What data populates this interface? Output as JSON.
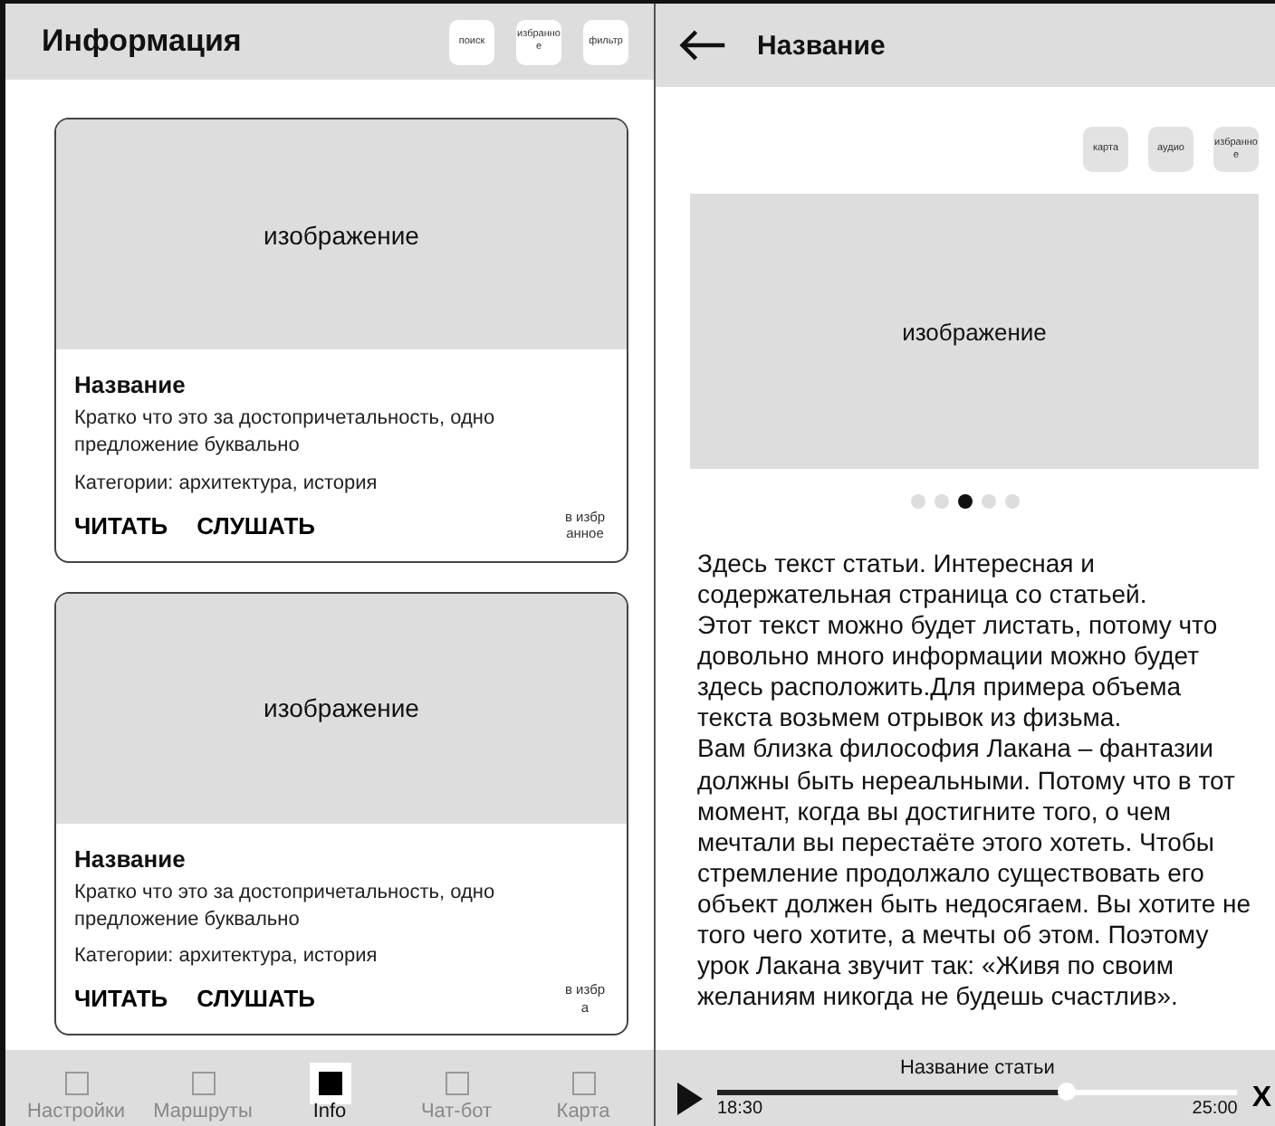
{
  "list_screen": {
    "title": "Информация",
    "header_buttons": [
      "поиск",
      "избранное",
      "фильтр"
    ],
    "cards": [
      {
        "image": "изображение",
        "title": "Название",
        "description": "Кратко что это за достопричетальность, одно предложение буквально",
        "categories": "Категории: архитектура, история",
        "read": "ЧИТАТЬ",
        "listen": "СЛУШАТЬ",
        "favorite": "в избранное"
      },
      {
        "image": "изображение",
        "title": "Название",
        "description": "Кратко что это за достопричетальность, одно предложение буквально",
        "categories": "Категории: архитектура, история",
        "read": "ЧИТАТЬ",
        "listen": "СЛУШАТЬ",
        "favorite": "в избра"
      }
    ],
    "nav": [
      {
        "label": "Настройки",
        "selected": false
      },
      {
        "label": "Маршруты",
        "selected": false
      },
      {
        "label": "Info",
        "selected": true
      },
      {
        "label": "Чат-бот",
        "selected": false
      },
      {
        "label": "Карта",
        "selected": false
      }
    ]
  },
  "article_screen": {
    "title": "Название",
    "action_buttons": [
      "карта",
      "аудио",
      "избранное"
    ],
    "image": "изображение",
    "dots": [
      {
        "selected": false
      },
      {
        "selected": false
      },
      {
        "selected": true
      },
      {
        "selected": false
      },
      {
        "selected": false
      }
    ],
    "paragraphs": [
      "Здесь текст статьи. Интересная и содержательная страница со статьей.",
      "Этот текст можно будет листать, потому что довольно много информации можно будет здесь расположить.Для примера объема текста возьмем отрывок из физьма.",
      "Вам близка философия Лакана – фантазии должны быть нереальными. Потому что в тот момент, когда вы достигните того, о чем мечтали вы перестаёте этого хотеть. Чтобы стремление продолжало существовать его объект должен быть недосягаем. Вы хотите не того чего хотите, а мечты об этом. Поэтому урок Лакана звучит так: «Живя по своим желаниям никогда не будешь счастлив»."
    ],
    "player": {
      "title": "Название статьи",
      "level": 0.67,
      "elapsed": "18:30",
      "total": "25:00",
      "close": "X"
    }
  }
}
